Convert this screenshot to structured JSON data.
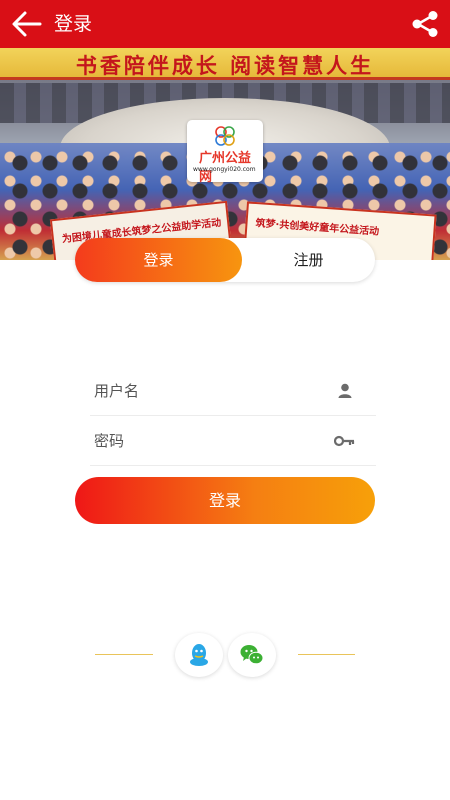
{
  "header": {
    "title": "登录",
    "back_icon": "arrow-left-icon",
    "share_icon": "share-icon"
  },
  "banner": {
    "slogan": "书香陪伴成长 阅读智慧人生",
    "sign_left": "为困境儿童成长筑梦之公益助学活动",
    "sign_right": "筑梦·共创美好童年公益活动"
  },
  "logo": {
    "brand": "广州公益网",
    "url": "www.gongyi020.com"
  },
  "tabs": {
    "login_label": "登录",
    "register_label": "注册"
  },
  "form": {
    "username_placeholder": "用户名",
    "password_placeholder": "密码",
    "username_icon": "user-icon",
    "password_icon": "key-icon"
  },
  "actions": {
    "login_label": "登录"
  },
  "social": {
    "qq_icon": "qq-icon",
    "wechat_icon": "wechat-icon"
  },
  "colors": {
    "header_bg": "#d90f16",
    "gradient_start": "#ef1717",
    "gradient_end": "#f7a009",
    "divider": "#e9c45a"
  }
}
